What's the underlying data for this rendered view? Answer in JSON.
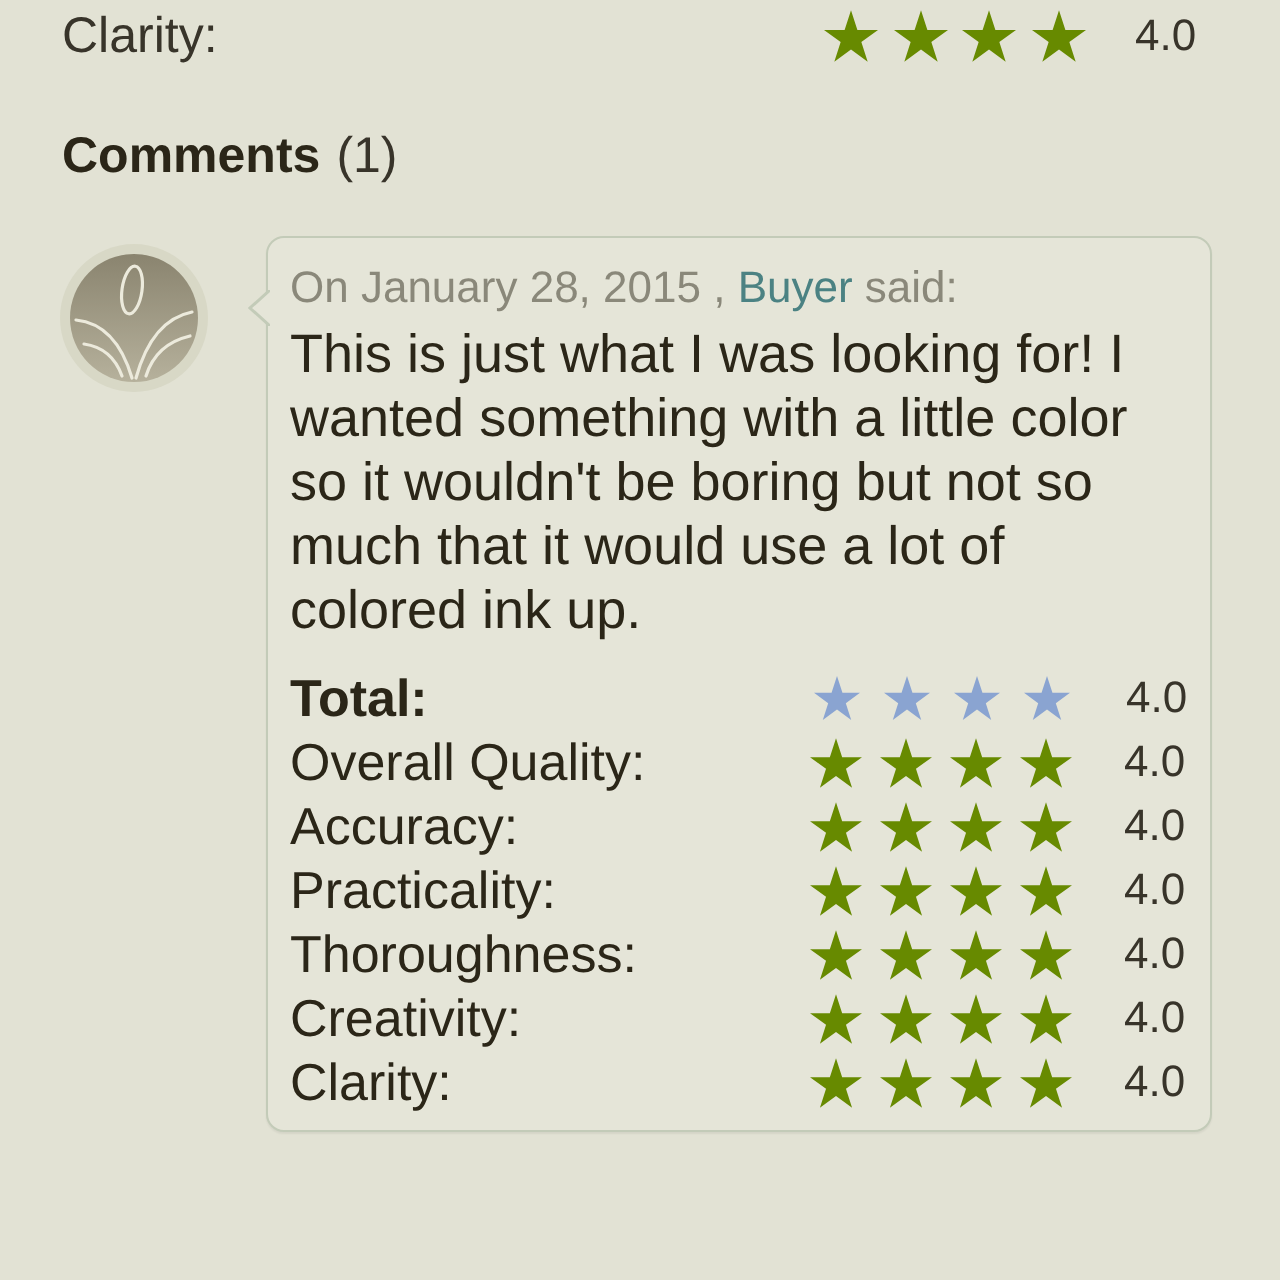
{
  "top_rating": {
    "label": "Clarity:",
    "stars": 4,
    "value": "4.0"
  },
  "comments": {
    "heading": "Comments",
    "count": "(1)",
    "items": [
      {
        "byline": {
          "prefix": "On January 28, 2015 ,",
          "author": "Buyer",
          "suffix": "said:"
        },
        "text": "This is just what I was looking for! I wanted something with a little color so it wouldn't be boring but not so much that it would use a lot of colored ink up.",
        "ratings": [
          {
            "kind": "total",
            "label": "Total:",
            "stars": 4,
            "value": "4.0"
          },
          {
            "kind": "criterion",
            "label": "Overall Quality:",
            "stars": 4,
            "value": "4.0"
          },
          {
            "kind": "criterion",
            "label": "Accuracy:",
            "stars": 4,
            "value": "4.0"
          },
          {
            "kind": "criterion",
            "label": "Practicality:",
            "stars": 4,
            "value": "4.0"
          },
          {
            "kind": "criterion",
            "label": "Thoroughness:",
            "stars": 4,
            "value": "4.0"
          },
          {
            "kind": "criterion",
            "label": "Creativity:",
            "stars": 4,
            "value": "4.0"
          },
          {
            "kind": "criterion",
            "label": "Clarity:",
            "stars": 4,
            "value": "4.0"
          }
        ]
      }
    ]
  }
}
